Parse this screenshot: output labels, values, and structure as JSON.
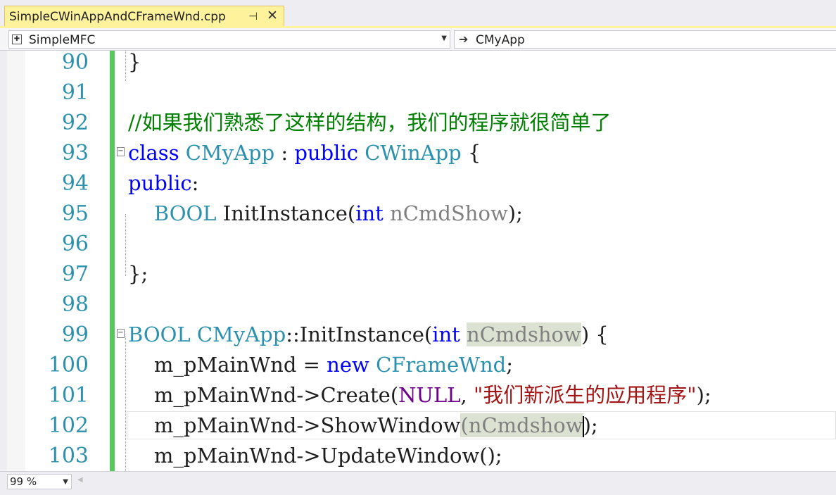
{
  "tab": {
    "title": "SimpleCWinAppAndCFrameWnd.cpp",
    "pin_glyph": "⊣",
    "close_glyph": "✕"
  },
  "nav": {
    "project": "SimpleMFC",
    "scope": "CMyApp"
  },
  "colors": {
    "tab_active": "#fff29d",
    "line_number": "#2b91af",
    "change_bar": "#57c75f",
    "keyword": "#0000ff",
    "type": "#2b91af",
    "comment": "#008000",
    "string": "#a31515"
  },
  "lines": [
    {
      "n": "90",
      "text": "}"
    },
    {
      "n": "91",
      "text": ""
    },
    {
      "n": "92",
      "text": "//如果我们熟悉了这样的结构，我们的程序就很简单了"
    },
    {
      "n": "93",
      "text": "class CMyApp : public CWinApp {"
    },
    {
      "n": "94",
      "text": "public:"
    },
    {
      "n": "95",
      "text": "    BOOL InitInstance(int nCmdShow);"
    },
    {
      "n": "96",
      "text": ""
    },
    {
      "n": "97",
      "text": "};"
    },
    {
      "n": "98",
      "text": ""
    },
    {
      "n": "99",
      "text": "BOOL CMyApp::InitInstance(int nCmdshow) {"
    },
    {
      "n": "100",
      "text": "    m_pMainWnd = new CFrameWnd;"
    },
    {
      "n": "101",
      "text": "    m_pMainWnd->Create(NULL, \"我们新派生的应用程序\");"
    },
    {
      "n": "102",
      "text": "    m_pMainWnd->ShowWindow(nCmdshow);"
    },
    {
      "n": "103",
      "text": "    m_pMainWnd->UpdateWindow();"
    }
  ],
  "tokens": {
    "l90": {
      "brace": "}"
    },
    "l92": {
      "comment": "//如果我们熟悉了这样的结构，我们的程序就很简单了"
    },
    "l93": {
      "kw_class": "class",
      "cls": "CMyApp",
      "colon": " : ",
      "kw_public": "public",
      "base": "CWinApp",
      "brace": " {"
    },
    "l94": {
      "kw_public": "public",
      "colon": ":"
    },
    "l95": {
      "indent": "    ",
      "type": "BOOL",
      "fn": " InitInstance(",
      "kw_int": "int",
      "param": " nCmdShow",
      "end": ");"
    },
    "l97": {
      "brace": "}",
      "semi": ";"
    },
    "l99": {
      "type": "BOOL",
      "cls": " CMyApp",
      "fn": "::InitInstance(",
      "kw_int": "int",
      "sp": " ",
      "param": "nCmdshow",
      "end": ") {"
    },
    "l100": {
      "indent": "    ",
      "a": "m_pMainWnd = ",
      "kw_new": "new",
      "sp": " ",
      "cls": "CFrameWnd",
      "end": ";"
    },
    "l101": {
      "indent": "    ",
      "a": "m_pMainWnd->Create(",
      "macro": "NULL",
      "comma": ", ",
      "str": "\"我们新派生的应用程序\"",
      "end": ");"
    },
    "l102": {
      "indent": "    ",
      "a": "m_pMainWnd->ShowWindow",
      "paren": "(",
      "param": "nCmdshow",
      "end": ");"
    },
    "l103": {
      "indent": "    ",
      "a": "m_pMainWnd->UpdateWindow();"
    }
  },
  "zoom": "99 %"
}
